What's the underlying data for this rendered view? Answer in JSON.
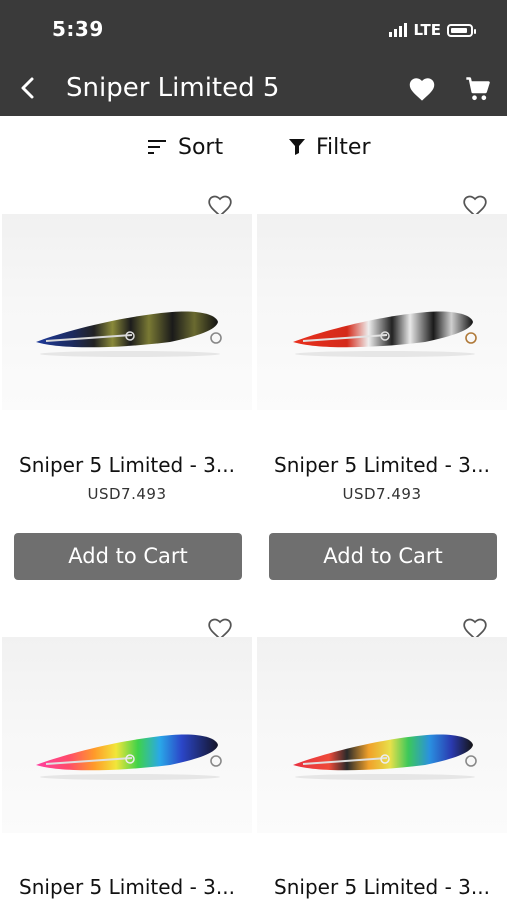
{
  "status": {
    "time": "5:39",
    "network": "LTE"
  },
  "header": {
    "title": "Sniper Limited 5",
    "icons": [
      "chevron-left-icon",
      "heart-icon",
      "cart-icon"
    ]
  },
  "toolbar": {
    "sort_label": "Sort",
    "filter_label": "Filter"
  },
  "products": [
    {
      "name": "Sniper 5 Limited - 3...",
      "price": "USD7.493",
      "button": "Add to Cart"
    },
    {
      "name": "Sniper 5 Limited - 3...",
      "price": "USD7.493",
      "button": "Add to Cart"
    },
    {
      "name": "Sniper 5 Limited - 3..."
    },
    {
      "name": "Sniper 5 Limited - 3..."
    }
  ],
  "colors": {
    "header_bg": "#3a3a3a",
    "button_bg": "#6f6f6f",
    "background": "#ffffff"
  }
}
